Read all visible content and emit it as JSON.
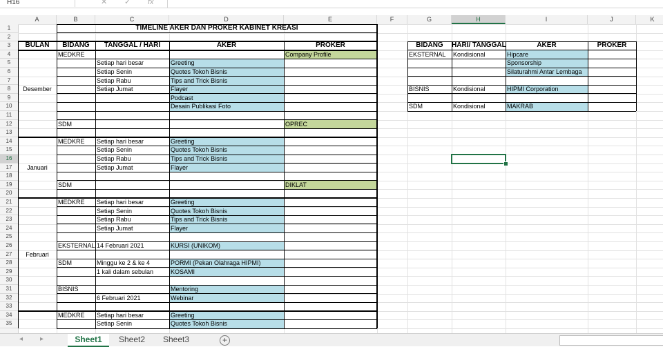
{
  "formula_bar": {
    "name_box": "H16",
    "cancel_icon": "✕",
    "enter_icon": "✓",
    "fx_label": "fx",
    "formula": ""
  },
  "columns": [
    "A",
    "B",
    "C",
    "D",
    "E",
    "F",
    "G",
    "H",
    "I",
    "J",
    "K"
  ],
  "rows": [
    "1",
    "2",
    "3",
    "4",
    "5",
    "6",
    "7",
    "8",
    "9",
    "10",
    "11",
    "12",
    "13",
    "14",
    "15",
    "16",
    "17",
    "18",
    "19",
    "20",
    "21",
    "22",
    "23",
    "24",
    "25",
    "26",
    "27",
    "28",
    "29",
    "30",
    "31",
    "32",
    "33",
    "34",
    "35"
  ],
  "active_cell": "H16",
  "colors": {
    "aker_fill": "#b7dee8",
    "proker_fill": "#c4d79b",
    "selection": "#217346"
  },
  "title": "TIMELINE AKER DAN PROKER KABINET KREASI",
  "table_headers": {
    "bulan": "BULAN",
    "bidang": "BIDANG",
    "tanggal": "TANGGAL / HARI",
    "aker": "AKER",
    "proker": "PROKER"
  },
  "months": [
    {
      "row": 8,
      "label": "Desember"
    },
    {
      "row": 17,
      "label": "Januari"
    },
    {
      "row": 27,
      "label": "Februari"
    }
  ],
  "bidang_cells": [
    {
      "row": 4,
      "text": "MEDKRE"
    },
    {
      "row": 12,
      "text": "SDM"
    },
    {
      "row": 14,
      "text": "MEDKRE"
    },
    {
      "row": 19,
      "text": "SDM"
    },
    {
      "row": 21,
      "text": "MEDKRE"
    },
    {
      "row": 26,
      "text": "EKSTERNAL"
    },
    {
      "row": 28,
      "text": "SDM"
    },
    {
      "row": 31,
      "text": "BISNIS"
    },
    {
      "row": 34,
      "text": "MEDKRE"
    }
  ],
  "tanggal_cells": [
    {
      "row": 5,
      "text": "Setiap hari besar"
    },
    {
      "row": 6,
      "text": "Setiap Senin"
    },
    {
      "row": 7,
      "text": "Setiap Rabu"
    },
    {
      "row": 8,
      "text": "Setiap Jumat"
    },
    {
      "row": 14,
      "text": "Setiap hari besar"
    },
    {
      "row": 15,
      "text": "Setiap Senin"
    },
    {
      "row": 16,
      "text": "Setiap Rabu"
    },
    {
      "row": 17,
      "text": "Setiap Jumat"
    },
    {
      "row": 21,
      "text": "Setiap hari besar"
    },
    {
      "row": 22,
      "text": "Setiap Senin"
    },
    {
      "row": 23,
      "text": "Setiap Rabu"
    },
    {
      "row": 24,
      "text": "Setiap Jumat"
    },
    {
      "row": 26,
      "text": "14 Februari 2021"
    },
    {
      "row": 28,
      "text": "Minggu ke 2 & ke 4"
    },
    {
      "row": 29,
      "text": "1 kali dalam sebulan"
    },
    {
      "row": 32,
      "text": "6 Februari 2021"
    },
    {
      "row": 34,
      "text": "Setiap hari besar"
    },
    {
      "row": 35,
      "text": "Setiap Senin"
    }
  ],
  "aker_cells": [
    {
      "row": 5,
      "text": "Greeting"
    },
    {
      "row": 6,
      "text": "Quotes Tokoh Bisnis"
    },
    {
      "row": 7,
      "text": "Tips and Trick Bisnis"
    },
    {
      "row": 8,
      "text": "Flayer"
    },
    {
      "row": 9,
      "text": "Podcast"
    },
    {
      "row": 10,
      "text": "Desain Publikasi Foto"
    },
    {
      "row": 14,
      "text": "Greeting"
    },
    {
      "row": 15,
      "text": "Quotes Tokoh Bisnis"
    },
    {
      "row": 16,
      "text": "Tips and Trick Bisnis"
    },
    {
      "row": 17,
      "text": "Flayer"
    },
    {
      "row": 21,
      "text": "Greeting"
    },
    {
      "row": 22,
      "text": "Quotes Tokoh Bisnis"
    },
    {
      "row": 23,
      "text": "Tips and Trick Bisnis"
    },
    {
      "row": 24,
      "text": "Flayer"
    },
    {
      "row": 26,
      "text": "KURSI (UNIKOM)"
    },
    {
      "row": 28,
      "text": "PORMI (Pekan Olahraga HIPMI)"
    },
    {
      "row": 29,
      "text": "KOSAMI"
    },
    {
      "row": 31,
      "text": "Mentoring"
    },
    {
      "row": 32,
      "text": "Webinar"
    },
    {
      "row": 34,
      "text": "Greeting"
    },
    {
      "row": 35,
      "text": "Quotes Tokoh Bisnis"
    }
  ],
  "proker_cells": [
    {
      "row": 4,
      "text": "Company Profile"
    },
    {
      "row": 12,
      "text": "OPREC"
    },
    {
      "row": 19,
      "text": "DIKLAT"
    }
  ],
  "right_headers": {
    "bidang": "BIDANG",
    "hari": "HARI/ TANGGAL",
    "aker": "AKER",
    "proker": "PROKER"
  },
  "right_rows": [
    {
      "row": 4,
      "bidang": "EKSTERNAL",
      "hari": "Kondisional",
      "aker": "Hipcare"
    },
    {
      "row": 5,
      "bidang": "",
      "hari": "",
      "aker": "Sponsorship"
    },
    {
      "row": 6,
      "bidang": "",
      "hari": "",
      "aker": "Silaturahmi Antar Lembaga"
    },
    {
      "row": 8,
      "bidang": "BISNIS",
      "hari": "Kondisional",
      "aker": "HIPMI Corporation"
    },
    {
      "row": 10,
      "bidang": "SDM",
      "hari": "Kondisional",
      "aker": "MAKRAB"
    }
  ],
  "sheet_tabs": [
    {
      "label": "Sheet1",
      "active": true
    },
    {
      "label": "Sheet2",
      "active": false
    },
    {
      "label": "Sheet3",
      "active": false
    }
  ],
  "add_sheet_label": "+"
}
